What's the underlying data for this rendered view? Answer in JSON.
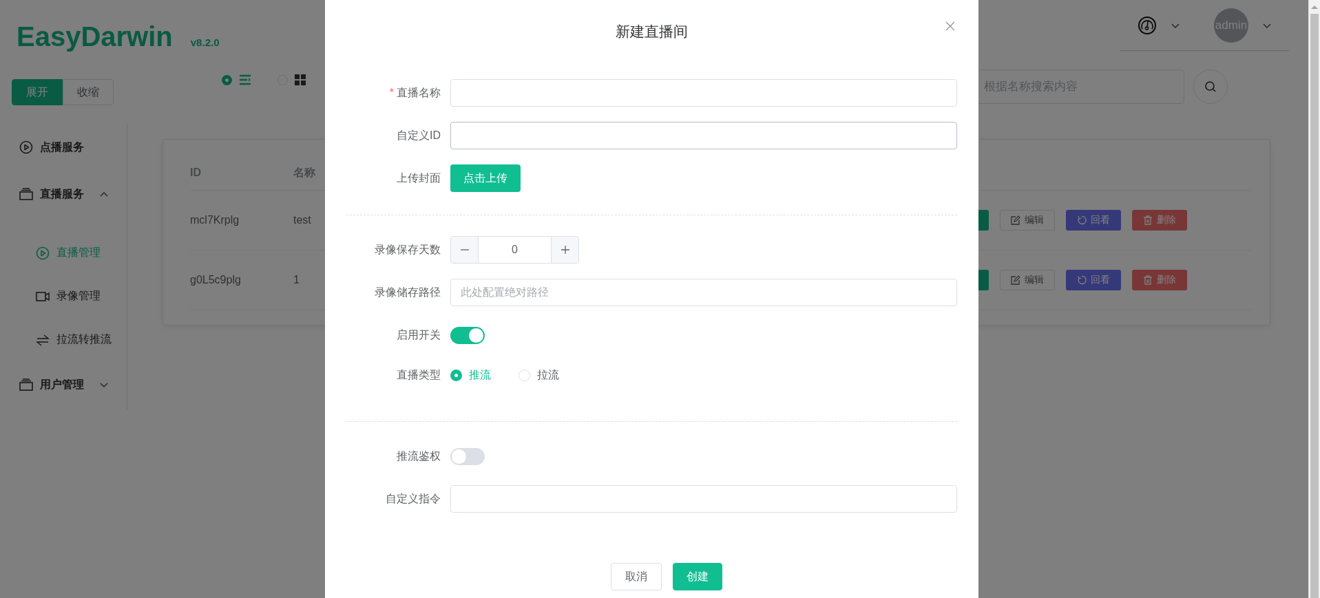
{
  "app": {
    "logo": "EasyDarwin",
    "version": "v8.2.0"
  },
  "header": {
    "avatar": "admin"
  },
  "expand_toggle": [
    {
      "label": "展开",
      "selected": true
    },
    {
      "label": "收缩",
      "selected": false
    }
  ],
  "view_mode": [
    {
      "kind": "list",
      "selected": true
    },
    {
      "kind": "grid",
      "selected": false
    }
  ],
  "search": {
    "placeholder": "根据名称搜索内容"
  },
  "sidebar": {
    "items": [
      {
        "label": "点播服务",
        "kind": "play",
        "selected": false
      },
      {
        "label": "直播服务",
        "kind": "stack",
        "selected": false,
        "expanded": true,
        "children": [
          {
            "label": "直播管理",
            "kind": "play",
            "selected": true
          },
          {
            "label": "录像管理",
            "kind": "camera",
            "selected": false
          },
          {
            "label": "拉流转推流",
            "kind": "swap",
            "selected": false
          }
        ]
      },
      {
        "label": "用户管理",
        "kind": "stack",
        "selected": false,
        "expanded": false
      }
    ]
  },
  "table": {
    "columns": [
      "ID",
      "名称"
    ],
    "rows": [
      {
        "cells": [
          "mcl7Krplg",
          "test"
        ],
        "actions": [
          {
            "kind": "primary"
          },
          {
            "kind": "edit",
            "label": "编辑"
          },
          {
            "kind": "replay",
            "label": "回看"
          },
          {
            "kind": "delete",
            "label": "删除"
          }
        ]
      },
      {
        "cells": [
          "g0L5c9plg",
          "1"
        ],
        "actions": [
          {
            "kind": "primary"
          },
          {
            "kind": "edit",
            "label": "编辑"
          },
          {
            "kind": "replay",
            "label": "回看"
          },
          {
            "kind": "delete",
            "label": "删除"
          }
        ]
      }
    ]
  },
  "dialog": {
    "title": "新建直播间",
    "sections": [
      {
        "fields": [
          {
            "kind": "text",
            "label": "直播名称",
            "required_mark": "*",
            "focused": false
          },
          {
            "kind": "text",
            "label": "自定义ID",
            "focused": true
          },
          {
            "kind": "upload",
            "label": "上传封面",
            "button": "点击上传"
          }
        ]
      },
      {
        "fields": [
          {
            "kind": "number",
            "label": "录像保存天数",
            "value": "0"
          },
          {
            "kind": "text",
            "label": "录像储存路径",
            "focused": false,
            "placeholder": "此处配置绝对路径"
          },
          {
            "kind": "switch",
            "label": "启用开关",
            "on": true
          },
          {
            "kind": "radio",
            "label": "直播类型",
            "options": [
              {
                "label": "推流",
                "selected": true
              },
              {
                "label": "拉流",
                "selected": false
              }
            ]
          }
        ]
      },
      {
        "fields": [
          {
            "kind": "switch",
            "label": "推流鉴权",
            "on": false
          },
          {
            "kind": "text",
            "label": "自定义指令",
            "focused": false
          }
        ]
      }
    ],
    "buttons": [
      {
        "kind": "cancel",
        "label": "取消"
      },
      {
        "kind": "primary",
        "label": "创建"
      }
    ]
  }
}
